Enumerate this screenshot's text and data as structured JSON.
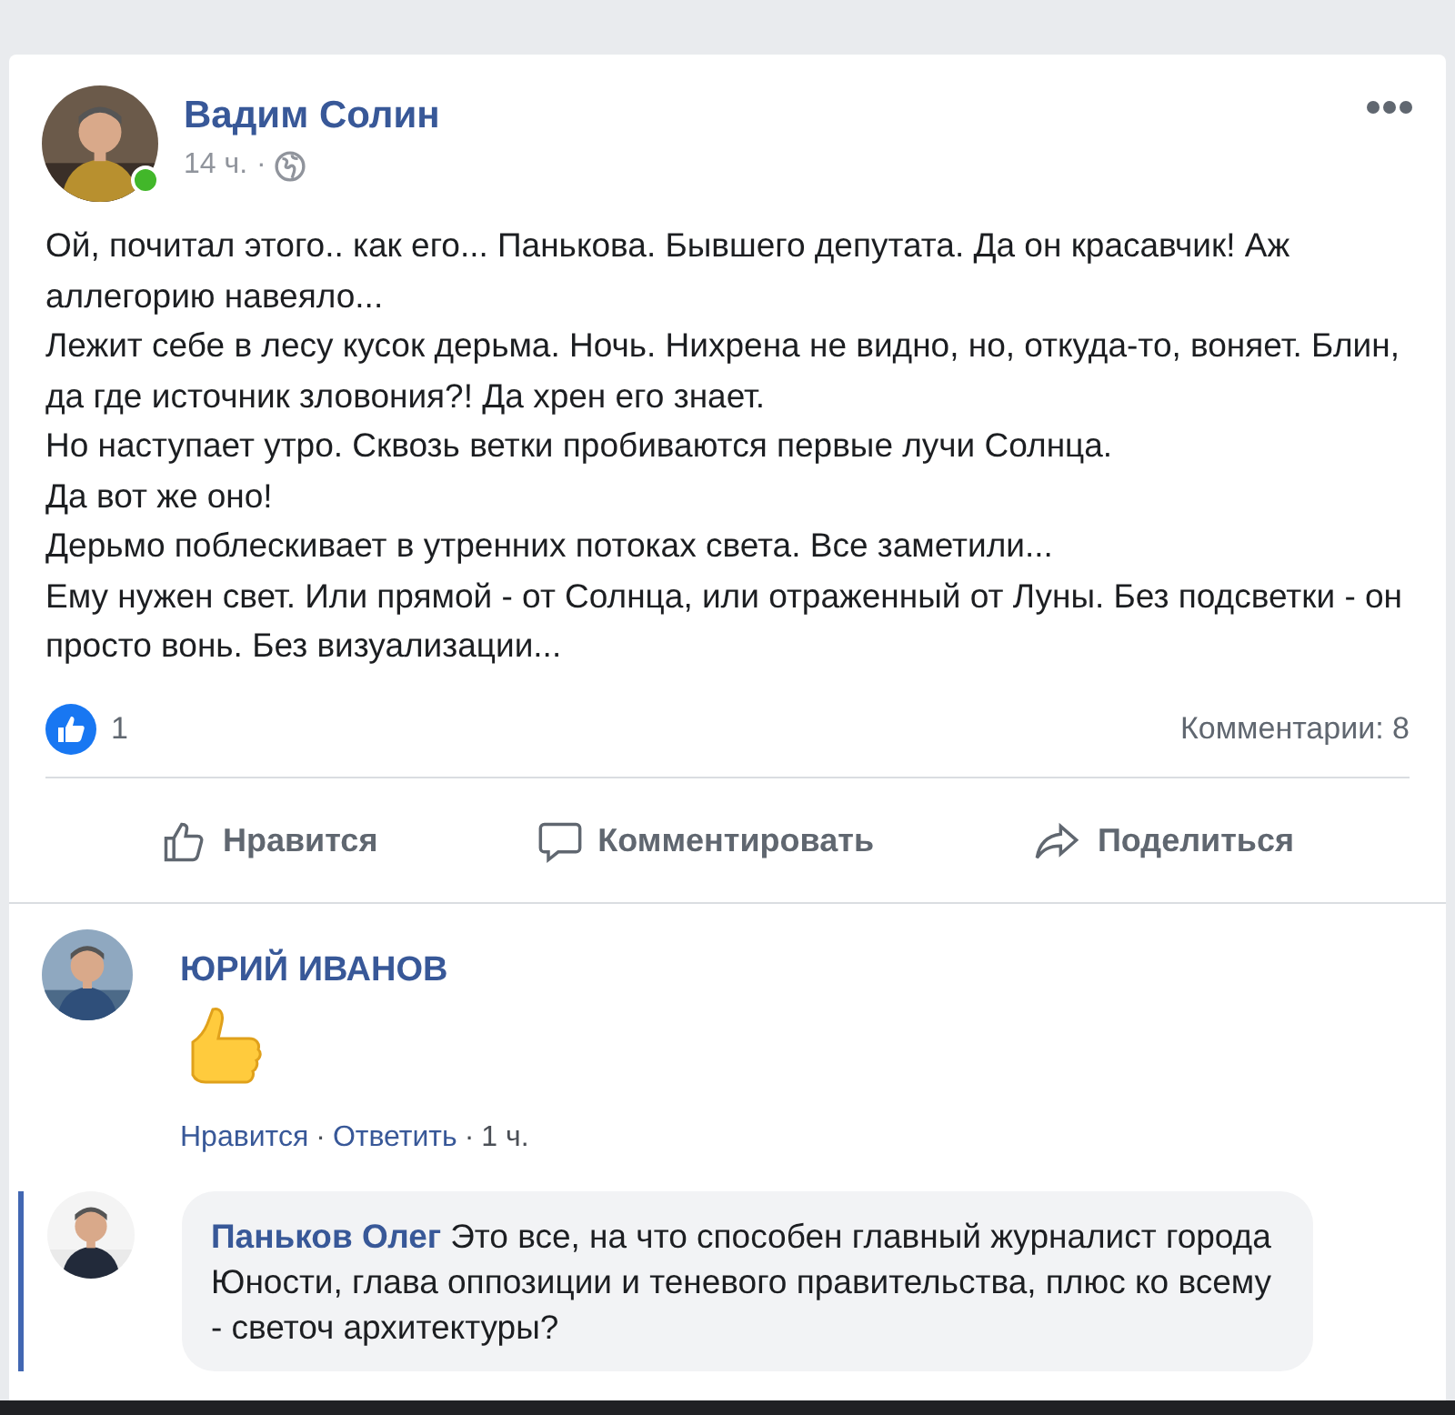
{
  "post": {
    "author": "Вадим Солин",
    "online": true,
    "time": "14 ч.",
    "separator": "·",
    "paragraphs": [
      "Ой, почитал этого.. как его... Панькова. Бывшего депутата. Да он красавчик! Аж аллегорию навеяло...",
      "Лежит себе в лесу кусок дерьма. Ночь. Нихрена не видно, но, откуда-то, воняет. Блин, да где источник зловония?! Да хрен его знает.",
      "Но наступает утро. Сквозь ветки пробиваются первые лучи Солнца.",
      "Да вот же оно!",
      "Дерьмо поблескивает в утренних потоках света. Все заметили...",
      "Ему нужен свет. Или прямой - от Солнца, или отраженный от Луны. Без подсветки - он просто вонь. Без визуализации..."
    ],
    "likes": "1",
    "comments_count": "Комментарии: 8",
    "actions": [
      {
        "label": "Нравится",
        "kind": "like"
      },
      {
        "label": "Комментировать",
        "kind": "comment"
      },
      {
        "label": "Поделиться",
        "kind": "share"
      }
    ]
  },
  "comments": [
    {
      "author": "ЮРИЙ ИВАНОВ",
      "kind": "sticker",
      "reply": false,
      "links": [
        "Нравится",
        "Ответить"
      ],
      "separator": "·",
      "time": "1 ч."
    },
    {
      "author": "Паньков Олег",
      "kind": "text",
      "reply": true,
      "text": "Это все, на что способен главный журналист города Юности, глава оппозиции и теневого правительства, плюс ко всему - светоч архитектуры?"
    }
  ]
}
